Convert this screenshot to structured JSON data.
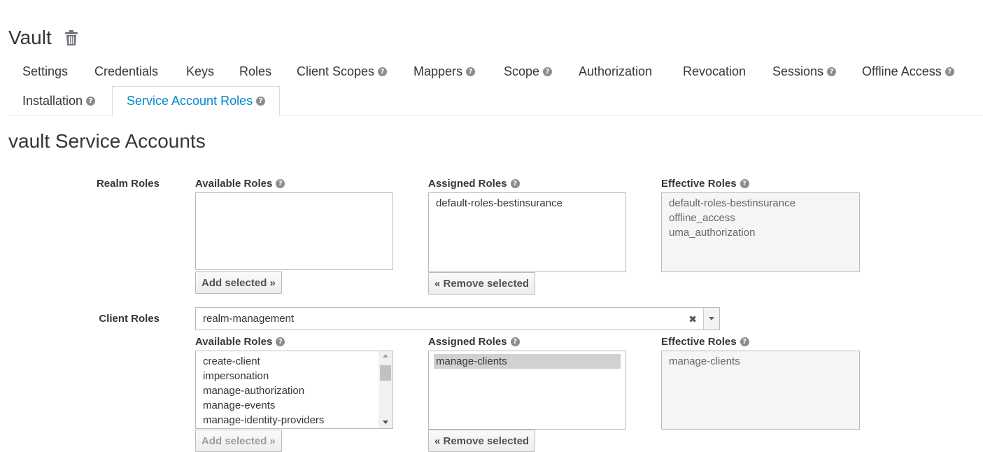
{
  "header": {
    "title": "Vault",
    "delete_icon": "trash-icon"
  },
  "tabs": [
    {
      "label": "Settings",
      "help": false
    },
    {
      "label": "Credentials",
      "help": false
    },
    {
      "label": "Keys",
      "help": false
    },
    {
      "label": "Roles",
      "help": false
    },
    {
      "label": "Client Scopes",
      "help": true
    },
    {
      "label": "Mappers",
      "help": true
    },
    {
      "label": "Scope",
      "help": true
    },
    {
      "label": "Authorization",
      "help": false
    },
    {
      "label": "Revocation",
      "help": false
    },
    {
      "label": "Sessions",
      "help": true
    },
    {
      "label": "Offline Access",
      "help": true
    },
    {
      "label": "Installation",
      "help": true
    },
    {
      "label": "Service Account Roles",
      "help": true,
      "active": true
    }
  ],
  "section_title": "vault Service Accounts",
  "realm_roles": {
    "label": "Realm Roles",
    "available_label": "Available Roles",
    "assigned_label": "Assigned Roles",
    "effective_label": "Effective Roles",
    "available": [],
    "assigned": [
      "default-roles-bestinsurance"
    ],
    "effective": [
      "default-roles-bestinsurance",
      "offline_access",
      "uma_authorization"
    ],
    "add_button": "Add selected »",
    "remove_button": "« Remove selected"
  },
  "client_roles": {
    "label": "Client Roles",
    "client_select_value": "realm-management",
    "clear_symbol": "✖",
    "available_label": "Available Roles",
    "assigned_label": "Assigned Roles",
    "effective_label": "Effective Roles",
    "available": [
      "create-client",
      "impersonation",
      "manage-authorization",
      "manage-events",
      "manage-identity-providers"
    ],
    "assigned": [
      "manage-clients"
    ],
    "assigned_selected": "manage-clients",
    "effective": [
      "manage-clients"
    ],
    "add_button": "Add selected »",
    "remove_button": "« Remove selected"
  },
  "colors": {
    "accent": "#0088ce",
    "text": "#363636",
    "help_icon": "#8b8d8f"
  },
  "help_symbol": "?"
}
